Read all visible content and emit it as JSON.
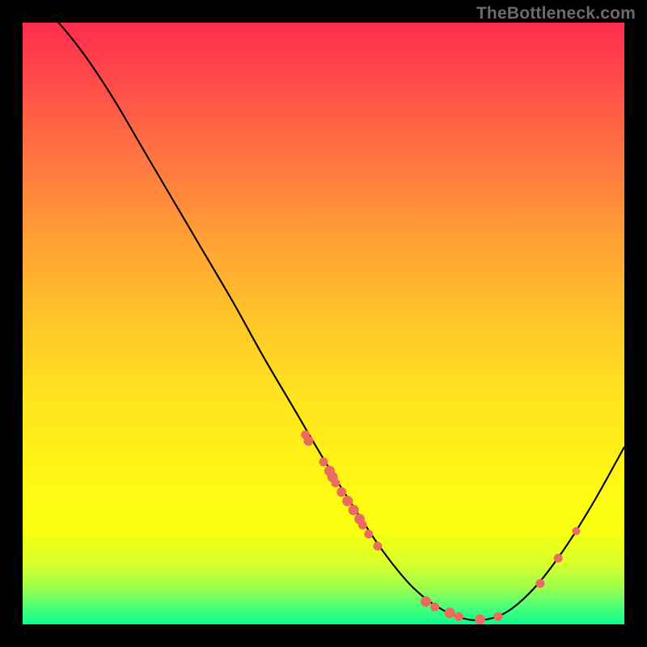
{
  "watermark": "TheBottleneck.com",
  "chart_data": {
    "type": "line",
    "title": "",
    "xlabel": "",
    "ylabel": "",
    "xlim": [
      0,
      100
    ],
    "ylim": [
      0,
      100
    ],
    "grid": false,
    "legend": false,
    "series": [
      {
        "name": "bottleneck-curve",
        "x": [
          0,
          5,
          10,
          15,
          20,
          25,
          30,
          35,
          40,
          45,
          50,
          55,
          60,
          65,
          70,
          75,
          80,
          85,
          90,
          95,
          100
        ],
        "y": [
          105,
          101,
          95,
          87.5,
          79,
          70.5,
          62,
          53.5,
          44.5,
          36,
          27.5,
          19.5,
          12,
          6,
          2.3,
          0.7,
          1.8,
          6,
          12.5,
          20.5,
          29.5
        ]
      }
    ],
    "scatter_points": {
      "name": "highlighted-points",
      "points": [
        {
          "x": 47,
          "y": 31.5,
          "r": 5
        },
        {
          "x": 47.5,
          "y": 30.5,
          "r": 5.5
        },
        {
          "x": 50,
          "y": 27,
          "r": 5
        },
        {
          "x": 51,
          "y": 25.5,
          "r": 6
        },
        {
          "x": 51.5,
          "y": 24.5,
          "r": 6
        },
        {
          "x": 52,
          "y": 23.5,
          "r": 5
        },
        {
          "x": 53,
          "y": 22,
          "r": 5.5
        },
        {
          "x": 54,
          "y": 20.5,
          "r": 6
        },
        {
          "x": 55,
          "y": 19,
          "r": 6
        },
        {
          "x": 56,
          "y": 17.5,
          "r": 6
        },
        {
          "x": 56.5,
          "y": 16.5,
          "r": 5
        },
        {
          "x": 57.5,
          "y": 15,
          "r": 5
        },
        {
          "x": 59,
          "y": 13,
          "r": 5
        },
        {
          "x": 67,
          "y": 3.8,
          "r": 6
        },
        {
          "x": 68.5,
          "y": 2.9,
          "r": 5
        },
        {
          "x": 71,
          "y": 1.9,
          "r": 6
        },
        {
          "x": 72.5,
          "y": 1.3,
          "r": 5
        },
        {
          "x": 76,
          "y": 0.8,
          "r": 6
        },
        {
          "x": 79,
          "y": 1.3,
          "r": 5
        },
        {
          "x": 86,
          "y": 6.8,
          "r": 5
        },
        {
          "x": 89,
          "y": 11,
          "r": 5
        },
        {
          "x": 92,
          "y": 15.5,
          "r": 4.5
        }
      ]
    },
    "colors": {
      "curve": "#000000",
      "dots": "#ec6b5f",
      "gradient_top": "#ff2c4e",
      "gradient_bottom": "#0cff8f",
      "frame": "#000000"
    }
  }
}
